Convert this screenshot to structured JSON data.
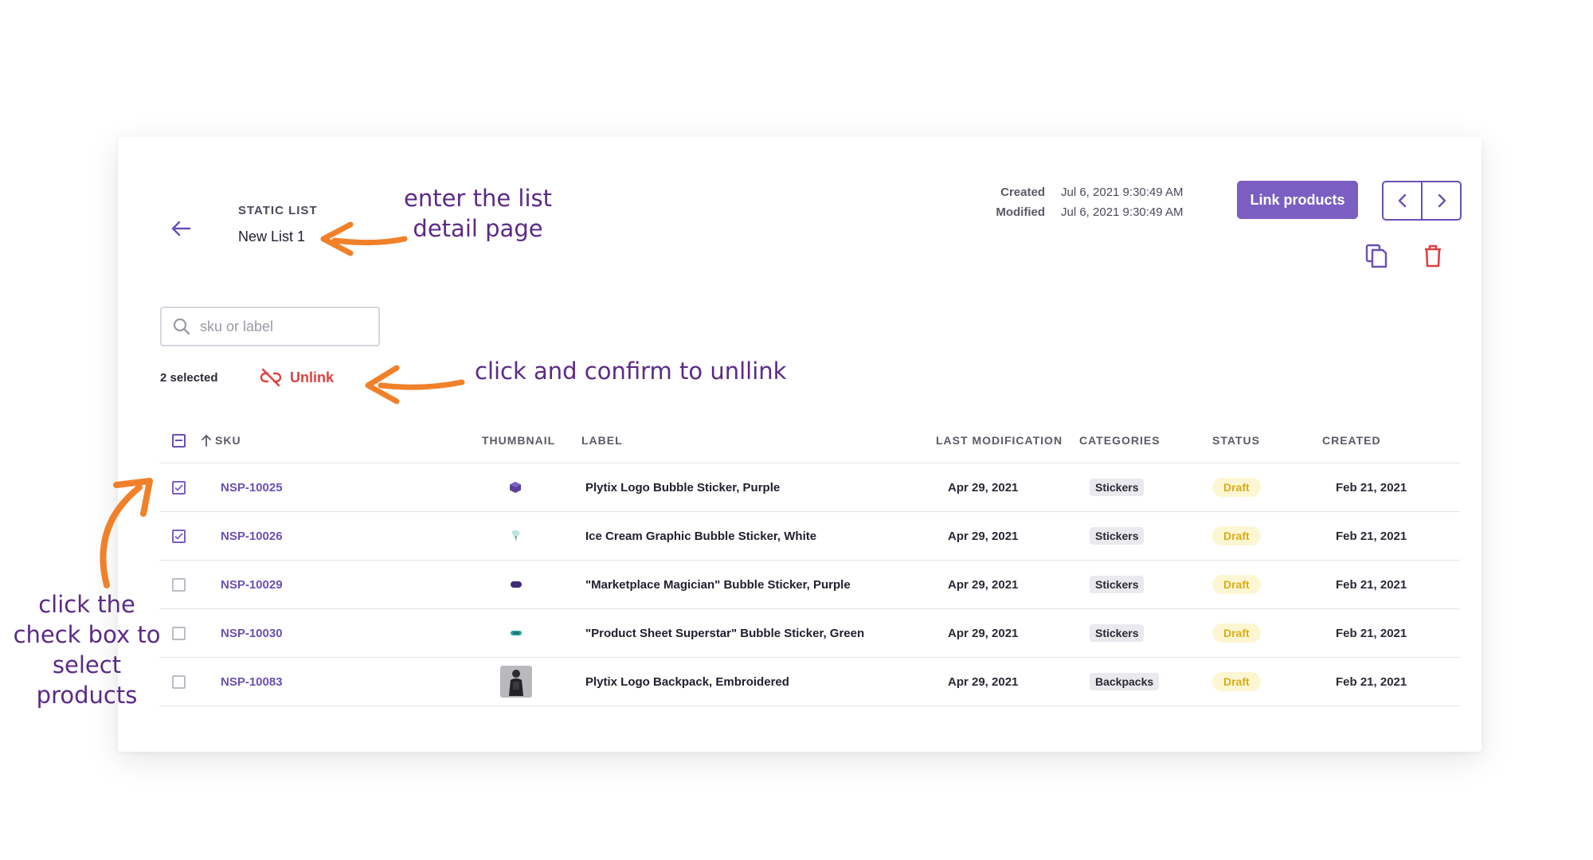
{
  "header": {
    "list_type": "STATIC LIST",
    "list_name": "New List 1",
    "created_label": "Created",
    "created_value": "Jul 6, 2021 9:30:49 AM",
    "modified_label": "Modified",
    "modified_value": "Jul 6, 2021 9:30:49 AM",
    "link_products_label": "Link products"
  },
  "search": {
    "placeholder": "sku or label",
    "value": ""
  },
  "selection": {
    "count_text": "2 selected",
    "unlink_label": "Unlink"
  },
  "table": {
    "columns": [
      "SKU",
      "THUMBNAIL",
      "LABEL",
      "LAST MODIFICATION",
      "CATEGORIES",
      "STATUS",
      "CREATED"
    ],
    "rows": [
      {
        "sku": "NSP-10025",
        "label": "Plytix Logo Bubble Sticker, Purple",
        "last_mod": "Apr 29, 2021",
        "category": "Stickers",
        "status": "Draft",
        "created": "Feb 21, 2021",
        "checked": true
      },
      {
        "sku": "NSP-10026",
        "label": "Ice Cream Graphic Bubble Sticker, White",
        "last_mod": "Apr 29, 2021",
        "category": "Stickers",
        "status": "Draft",
        "created": "Feb 21, 2021",
        "checked": true
      },
      {
        "sku": "NSP-10029",
        "label": "\"Marketplace Magician\" Bubble Sticker, Purple",
        "last_mod": "Apr 29, 2021",
        "category": "Stickers",
        "status": "Draft",
        "created": "Feb 21, 2021",
        "checked": false
      },
      {
        "sku": "NSP-10030",
        "label": "\"Product Sheet Superstar\" Bubble Sticker, Green",
        "last_mod": "Apr 29, 2021",
        "category": "Stickers",
        "status": "Draft",
        "created": "Feb 21, 2021",
        "checked": false
      },
      {
        "sku": "NSP-10083",
        "label": "Plytix Logo Backpack, Embroidered",
        "last_mod": "Apr 29, 2021",
        "category": "Backpacks",
        "status": "Draft",
        "created": "Feb 21, 2021",
        "checked": false
      }
    ]
  },
  "annotations": {
    "enter_line1": "enter the list",
    "enter_line2": "detail page",
    "unlink_note": "click and confirm to unllink",
    "check_line1": "click the",
    "check_line2": "check box to",
    "check_line3": "select products"
  },
  "colors": {
    "accent": "#7b5ec2",
    "danger": "#e04040",
    "draft": "#d9ad14",
    "annotation": "#5b2a86",
    "arrow": "#f0812a"
  },
  "icons": [
    "back-arrow-icon",
    "chevron-left-icon",
    "chevron-right-icon",
    "copy-icon",
    "trash-icon",
    "search-icon",
    "unlink-icon",
    "sort-up-icon"
  ]
}
